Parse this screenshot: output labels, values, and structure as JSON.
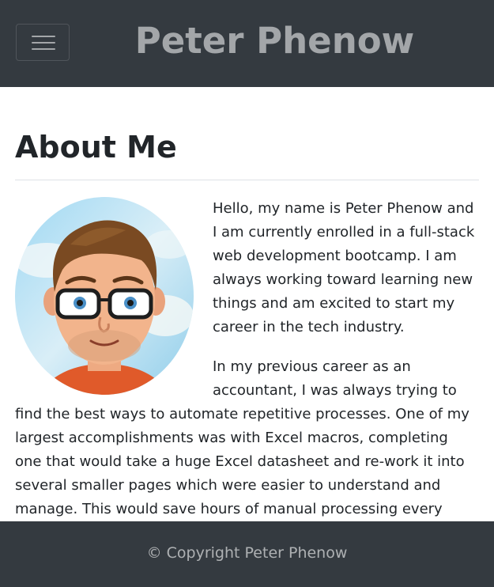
{
  "navbar": {
    "brand": "Peter Phenow",
    "toggle_icon": "hamburger-menu-icon"
  },
  "about": {
    "heading": "About Me",
    "avatar_icon": "avatar-bitmoji",
    "paragraphs": [
      "Hello, my name is Peter Phenow and I am currently enrolled in a full-stack web development bootcamp. I am always working toward learning new things and am excited to start my career in the tech industry.",
      "In my previous career as an accountant, I was always trying to find the best ways to automate repetitive processes. One of my largest accomplishments was with Excel macros, completing one that would take a huge Excel datasheet and re-work it into several smaller pages which were easier to understand and manage. This would save hours of manual processing every week."
    ]
  },
  "footer": {
    "text": "© Copyright Peter Phenow"
  },
  "colors": {
    "navbar_bg": "#343a40",
    "text": "#212529",
    "rule": "#dee2e6"
  }
}
